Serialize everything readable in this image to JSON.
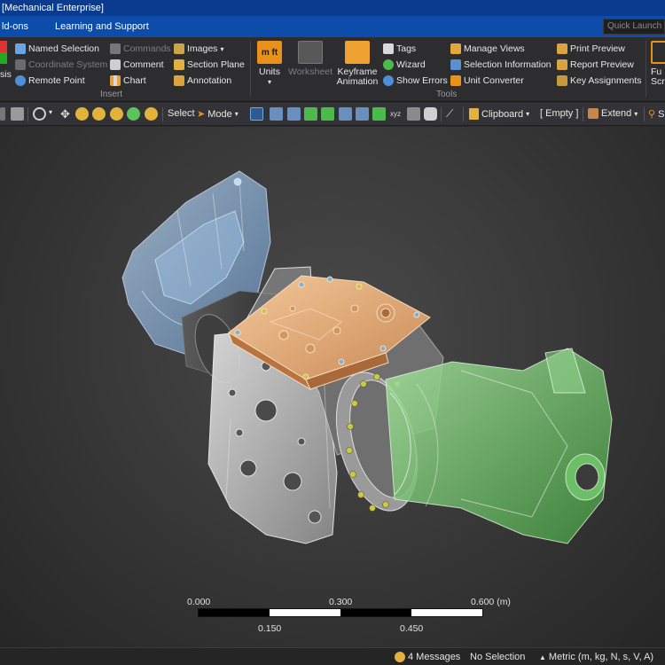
{
  "window": {
    "title": "[Mechanical Enterprise]"
  },
  "menu": {
    "tabs": [
      "ld-ons",
      "Learning and Support"
    ],
    "quick_launch_placeholder": "Quick Launch"
  },
  "ribbon": {
    "left_partial": {
      "line1": "sis"
    },
    "insert": {
      "label": "Insert",
      "items": [
        {
          "label": "Named Selection",
          "icon": "named-selection-icon",
          "enabled": true
        },
        {
          "label": "Coordinate System",
          "icon": "coordinate-system-icon",
          "enabled": false
        },
        {
          "label": "Remote Point",
          "icon": "remote-point-icon",
          "enabled": true
        },
        {
          "label": "Commands",
          "icon": "commands-icon",
          "enabled": false
        },
        {
          "label": "Comment",
          "icon": "comment-icon",
          "enabled": true
        },
        {
          "label": "Chart",
          "icon": "chart-icon",
          "enabled": true
        },
        {
          "label": "Images",
          "icon": "images-icon",
          "enabled": true
        },
        {
          "label": "Section Plane",
          "icon": "section-plane-icon",
          "enabled": true
        },
        {
          "label": "Annotation",
          "icon": "annotation-icon",
          "enabled": true
        }
      ]
    },
    "tools": {
      "label": "Tools",
      "units": {
        "label": "Units",
        "icon_text": "m ft"
      },
      "worksheet": {
        "label": "Worksheet"
      },
      "keyframe": {
        "label1": "Keyframe",
        "label2": "Animation"
      },
      "items": [
        {
          "label": "Tags",
          "icon": "tags-icon"
        },
        {
          "label": "Wizard",
          "icon": "wizard-icon"
        },
        {
          "label": "Show Errors",
          "icon": "show-errors-icon"
        },
        {
          "label": "Manage Views",
          "icon": "manage-views-icon"
        },
        {
          "label": "Selection Information",
          "icon": "selection-information-icon"
        },
        {
          "label": "Unit Converter",
          "icon": "unit-converter-icon"
        },
        {
          "label": "Print Preview",
          "icon": "print-preview-icon"
        },
        {
          "label": "Report Preview",
          "icon": "report-preview-icon"
        },
        {
          "label": "Key Assignments",
          "icon": "key-assignments-icon"
        }
      ],
      "right_partial": {
        "line1": "Fu",
        "line2": "Scr"
      }
    }
  },
  "toolbar": {
    "select_label": "Select",
    "mode_label": "Mode",
    "clipboard_label": "Clipboard",
    "empty_label": "[ Empty ]",
    "extend_label": "Extend",
    "partial_label": "S"
  },
  "viewport": {
    "scale": {
      "top_labels": [
        "0.000",
        "0.300",
        "0.600 (m)"
      ],
      "bottom_labels": [
        "0.150",
        "0.450"
      ],
      "segments": 4
    }
  },
  "status": {
    "messages": "4 Messages",
    "selection": "No Selection",
    "units": "Metric (m, kg, N, s, V, A)"
  },
  "colors": {
    "title_bar": "#0b3b8e",
    "menu_bar": "#0d4ca8",
    "body_blue": "#a9c8e8",
    "body_orange": "#e8b07f",
    "body_green": "#8fd08a",
    "body_gray": "#d0d0d0"
  }
}
